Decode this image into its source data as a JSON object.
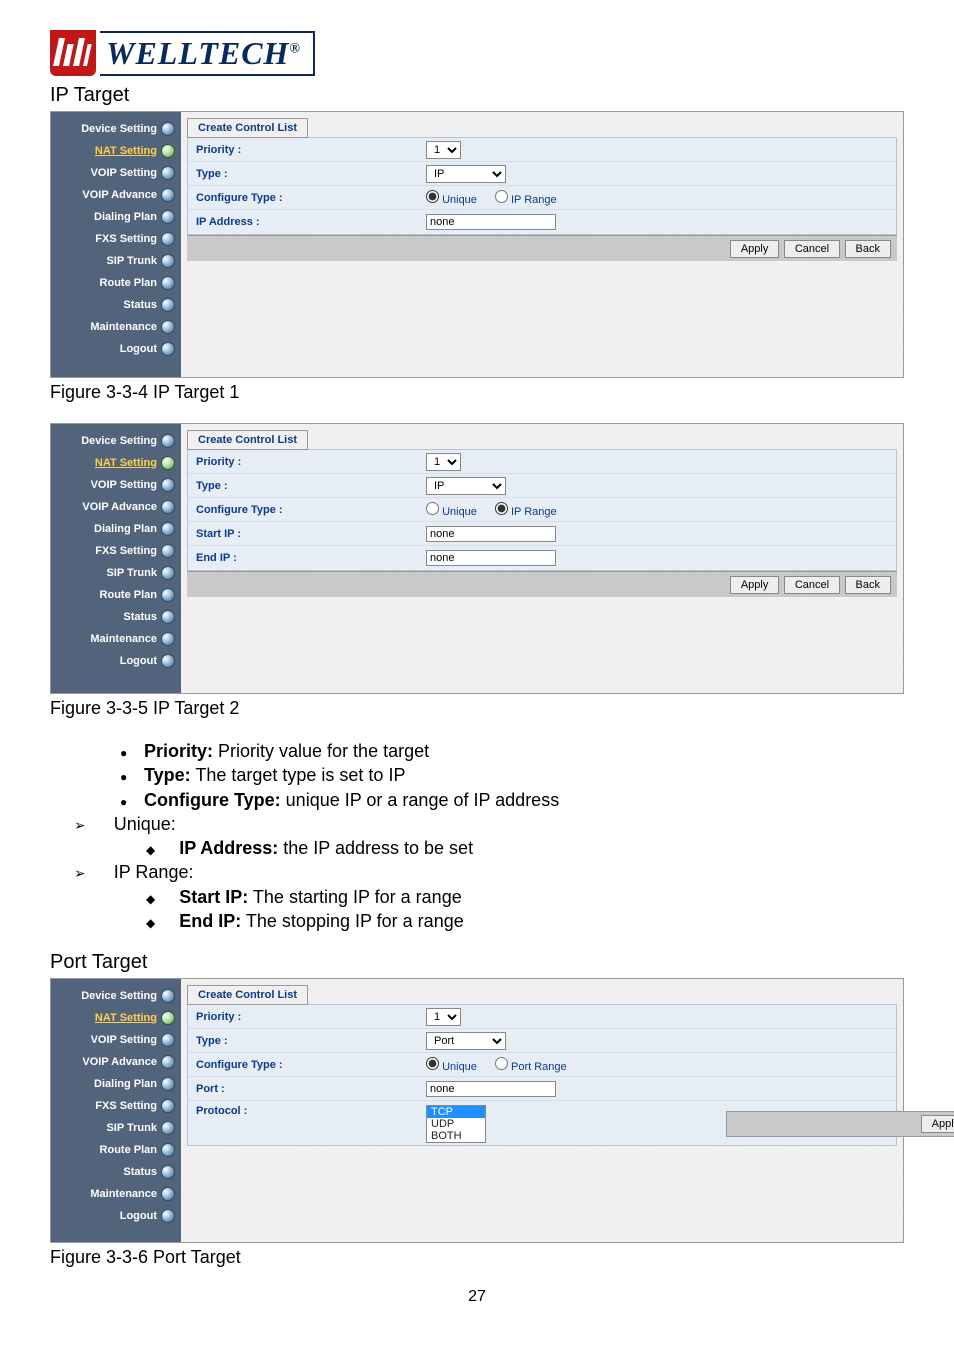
{
  "logo_text": "WELLTECH",
  "sections": {
    "ip_target": "IP Target",
    "port_target": "Port Target"
  },
  "captions": {
    "fig1": "Figure 3-3-4 IP Target 1",
    "fig2": "Figure 3-3-5 IP Target 2",
    "fig3": "Figure 3-3-6 Port Target"
  },
  "sidebar": {
    "items": [
      {
        "label": "Device Setting",
        "name": "device-setting"
      },
      {
        "label": "NAT Setting",
        "name": "nat-setting",
        "active": true
      },
      {
        "label": "VOIP Setting",
        "name": "voip-setting"
      },
      {
        "label": "VOIP Advance",
        "name": "voip-advance"
      },
      {
        "label": "Dialing Plan",
        "name": "dialing-plan"
      },
      {
        "label": "FXS Setting",
        "name": "fxs-setting"
      },
      {
        "label": "SIP Trunk",
        "name": "sip-trunk"
      },
      {
        "label": "Route Plan",
        "name": "route-plan"
      },
      {
        "label": "Status",
        "name": "status"
      },
      {
        "label": "Maintenance",
        "name": "maintenance"
      },
      {
        "label": "Logout",
        "name": "logout"
      }
    ]
  },
  "tab_label": "Create Control List",
  "form_labels": {
    "priority": "Priority :",
    "type": "Type :",
    "configure_type": "Configure Type :",
    "ip_address": "IP Address :",
    "start_ip": "Start IP :",
    "end_ip": "End IP :",
    "port": "Port :",
    "protocol": "Protocol :"
  },
  "values": {
    "priority": "1",
    "type_ip": "IP",
    "type_port": "Port",
    "none": "none",
    "protocol_options": [
      "TCP",
      "UDP",
      "BOTH"
    ]
  },
  "radios": {
    "unique": "Unique",
    "ip_range": "IP Range",
    "port_range": "Port Range"
  },
  "buttons": {
    "apply": "Apply",
    "cancel": "Cancel",
    "back": "Back"
  },
  "desc": {
    "priority": {
      "b": "Priority:",
      "t": " Priority value for the target"
    },
    "type": {
      "b": "Type:",
      "t": " The target type is set to IP"
    },
    "configure_type": {
      "b": "Configure Type:",
      "t": " unique IP or a range of IP address"
    },
    "unique_h": "Unique:",
    "ip_address": {
      "b": "IP Address:",
      "t": " the IP address to be set"
    },
    "iprange_h": "IP Range:",
    "start_ip": {
      "b": "Start IP:",
      "t": " The starting IP for a range"
    },
    "end_ip": {
      "b": "End IP:",
      "t": " The stopping IP for a range"
    }
  },
  "page_number": "27"
}
